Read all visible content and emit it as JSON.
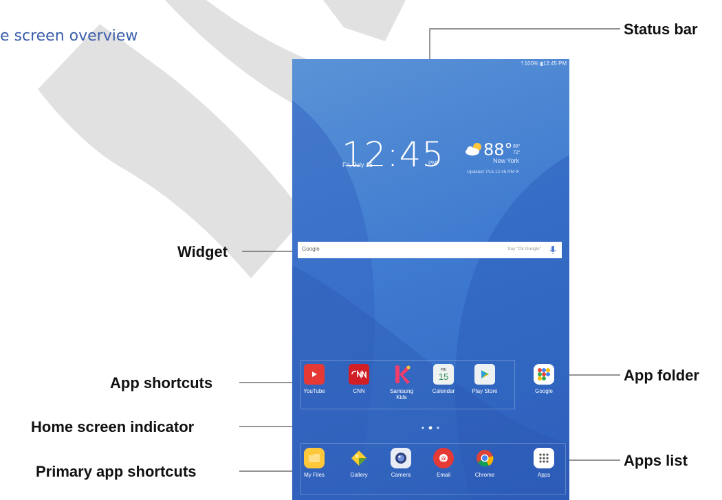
{
  "title": "e screen overview",
  "callouts": {
    "status_bar": "Status bar",
    "widget": "Widget",
    "app_shortcuts": "App shortcuts",
    "app_folder": "App folder",
    "home_indicator": "Home screen indicator",
    "primary_shortcuts": "Primary app shortcuts",
    "apps_list": "Apps list"
  },
  "tablet": {
    "status_text": "⇡100% ▮12:45 PM",
    "clock": "12:45",
    "ampm": "PM",
    "date": "Fri, July 15",
    "temp": "88°",
    "temp_high": "88°",
    "temp_low": "72°",
    "city": "New York",
    "updated": "Updated 7/15 12:45 PM ⟳",
    "search_brand": "Google",
    "search_hint": "Say \"Ok Google\"",
    "apps": [
      "YouTube",
      "CNN",
      "Samsung Kids",
      "Calendar",
      "Play Store",
      "Google"
    ],
    "calendar_day": "15",
    "calendar_weekday": "FRI",
    "dock": [
      "My Files",
      "Gallery",
      "Camera",
      "Email",
      "Chrome",
      "Apps"
    ]
  },
  "colors": {
    "title": "#3a5ea8",
    "youtube": "#e53935",
    "cnn": "#d21f26",
    "watermark": "#dddddd"
  }
}
